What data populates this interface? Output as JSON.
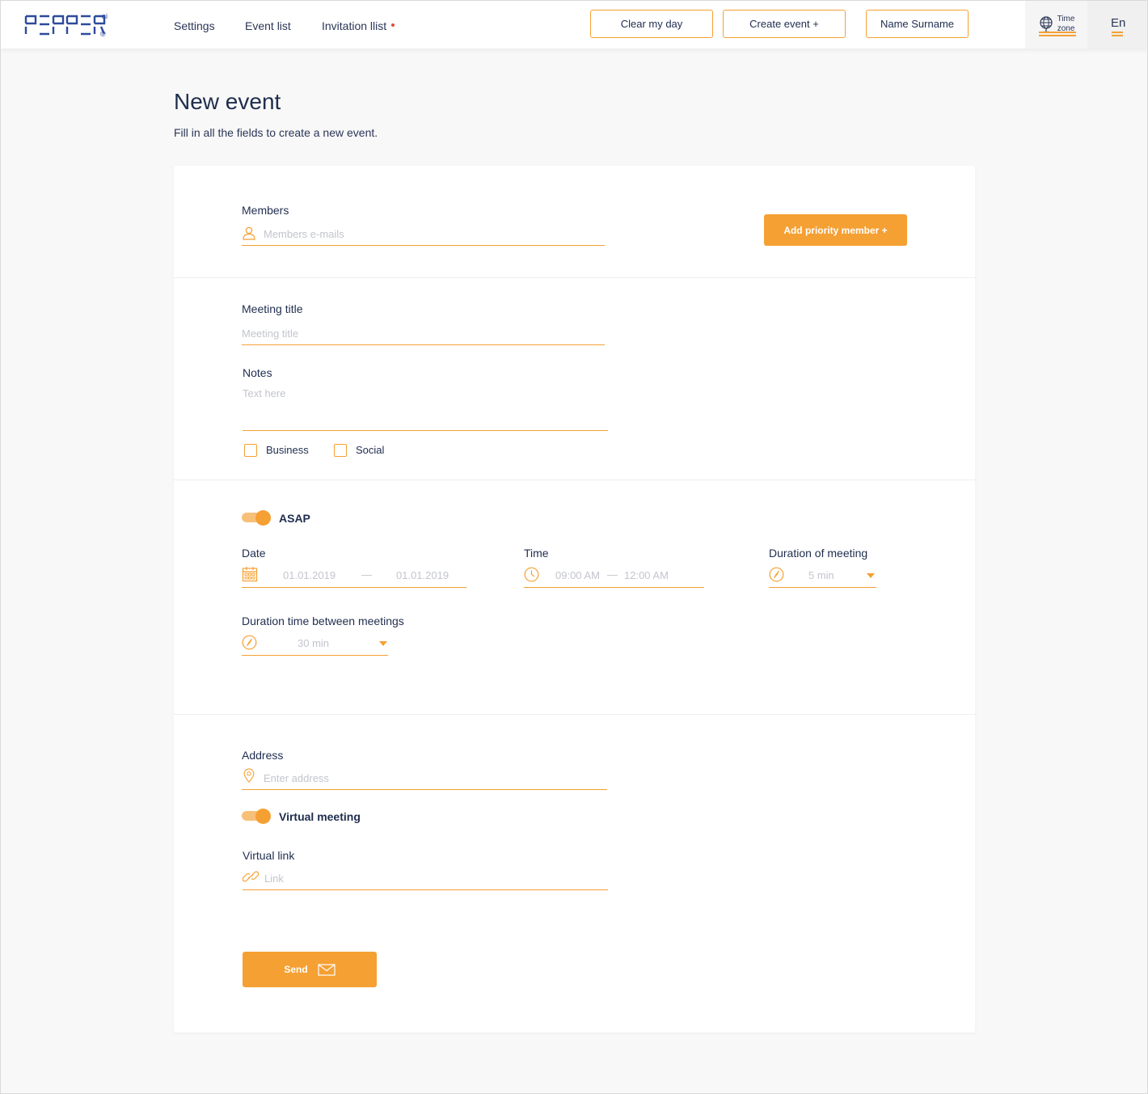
{
  "colors": {
    "accent": "#f5a033",
    "text": "#1f2d4e",
    "muted": "#c2c5cc",
    "alert_dot": "#e74c3c"
  },
  "header": {
    "logo_text": "PEPPER",
    "logo_sup": "ai",
    "logo_mark": "©",
    "nav": [
      {
        "label": "Settings"
      },
      {
        "label": "Event list"
      },
      {
        "label": "Invitation llist"
      }
    ],
    "buttons": {
      "clear_day": "Clear my day",
      "create_event": "Create event +",
      "user_name": "Name Surname"
    },
    "timezone": {
      "line1": "Time",
      "line2": "zone",
      "icon": "globe-icon"
    },
    "language": "En"
  },
  "page": {
    "title": "New event",
    "subtitle": "Fill in all the fields to create a new event."
  },
  "members": {
    "label": "Members",
    "placeholder": "Members e-mails",
    "icon": "user-icon",
    "add_priority_label": "Add priority member +"
  },
  "meeting": {
    "title_label": "Meeting title",
    "title_placeholder": "Meeting title",
    "notes_label": "Notes",
    "notes_placeholder": "Text here",
    "categories": [
      {
        "label": "Business",
        "checked": false
      },
      {
        "label": "Social",
        "checked": false
      }
    ]
  },
  "schedule": {
    "asap_label": "ASAP",
    "asap_on": true,
    "date_label": "Date",
    "date_from": "01.01.2019",
    "date_to": "01.01.2019",
    "date_sep": "—",
    "time_label": "Time",
    "time_from": "09:00 AM",
    "time_to": "12:00 AM",
    "time_sep": "—",
    "duration_label": "Duration of meeting",
    "duration_value": "5 min",
    "between_label": "Duration time between meetings",
    "between_value": "30 min"
  },
  "location": {
    "address_label": "Address",
    "address_placeholder": "Enter address",
    "virtual_label": "Virtual meeting",
    "virtual_on": true,
    "link_label": "Virtual link",
    "link_placeholder": "Link"
  },
  "send_label": "Send"
}
